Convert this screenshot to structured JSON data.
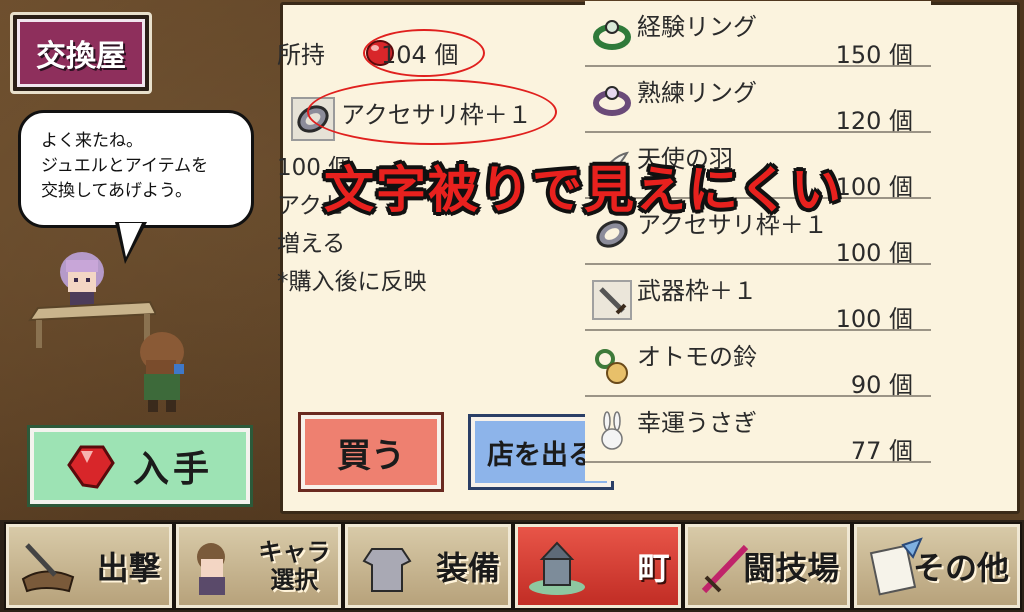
{
  "shop": {
    "title": "交換屋"
  },
  "dialog": {
    "lines": [
      "よく来たね。",
      "ジュエルとアイテムを",
      "交換してあげよう。"
    ]
  },
  "obtain_button": {
    "label": "入手"
  },
  "detail": {
    "owned_label": "所持",
    "owned_count": "104 個",
    "selected_name": "アクセサリ枠＋１",
    "desc_lines": [
      "100 個",
      "アクセ",
      "増える",
      "*購入後に反映"
    ]
  },
  "actions": {
    "buy": "買う",
    "leave": "店を出る"
  },
  "items": [
    {
      "name": "経験リング",
      "price": "150 個",
      "icon": "ring-icon"
    },
    {
      "name": "熟練リング",
      "price": "120 個",
      "icon": "ring-icon"
    },
    {
      "name": "天使の羽",
      "price": "100 個",
      "icon": "feather-icon"
    },
    {
      "name": "アクセサリ枠＋１",
      "price": "100 個",
      "icon": "accessory-slot-icon"
    },
    {
      "name": "武器枠＋１",
      "price": "100 個",
      "icon": "sword-icon"
    },
    {
      "name": "オトモの鈴",
      "price": "90 個",
      "icon": "bell-icon"
    },
    {
      "name": "幸運うさぎ",
      "price": "77 個",
      "icon": "rabbit-icon"
    }
  ],
  "overlay_text": "文字被りで見えにくい",
  "nav": [
    {
      "label": "出撃",
      "icon": "sortie-icon",
      "active": false
    },
    {
      "label": "キャラ\n選択",
      "line1": "キャラ",
      "line2": "選択",
      "icon": "character-icon",
      "active": false
    },
    {
      "label": "装備",
      "icon": "armor-icon",
      "active": false
    },
    {
      "label": "町",
      "icon": "town-icon",
      "active": true
    },
    {
      "label": "闘技場",
      "icon": "sword-arena-icon",
      "active": false
    },
    {
      "label": "その他",
      "icon": "scroll-icon",
      "active": false
    }
  ],
  "colors": {
    "panel_bg": "#fbf3de",
    "highlight_circle": "#e0201e",
    "overlay_text": "#e8211e",
    "buy_button": "#ee8070",
    "leave_button": "#8db4ea",
    "obtain_button": "#9de3b4",
    "active_nav": "#d23a30"
  }
}
